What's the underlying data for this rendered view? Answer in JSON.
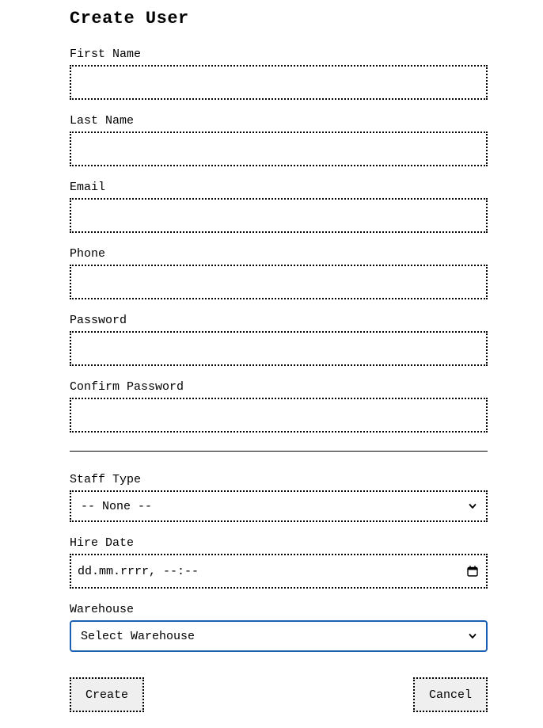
{
  "form": {
    "title": "Create User",
    "fields": {
      "first_name": {
        "label": "First Name",
        "value": ""
      },
      "last_name": {
        "label": "Last Name",
        "value": ""
      },
      "email": {
        "label": "Email",
        "value": ""
      },
      "phone": {
        "label": "Phone",
        "value": ""
      },
      "password": {
        "label": "Password",
        "value": ""
      },
      "confirm_password": {
        "label": "Confirm Password",
        "value": ""
      }
    },
    "staff_type": {
      "label": "Staff Type",
      "selected": "-- None --"
    },
    "hire_date": {
      "label": "Hire Date",
      "placeholder": "dd.mm.rrrr, --:--"
    },
    "warehouse": {
      "label": "Warehouse",
      "selected": "Select Warehouse"
    },
    "buttons": {
      "create": "Create",
      "cancel": "Cancel"
    }
  },
  "colors": {
    "focus_border": "#1a5fb4",
    "button_bg": "#efefef",
    "text": "#000000",
    "background": "#ffffff"
  },
  "icons": {
    "select_arrow": "chevron-down-icon",
    "date_picker": "calendar-icon"
  }
}
